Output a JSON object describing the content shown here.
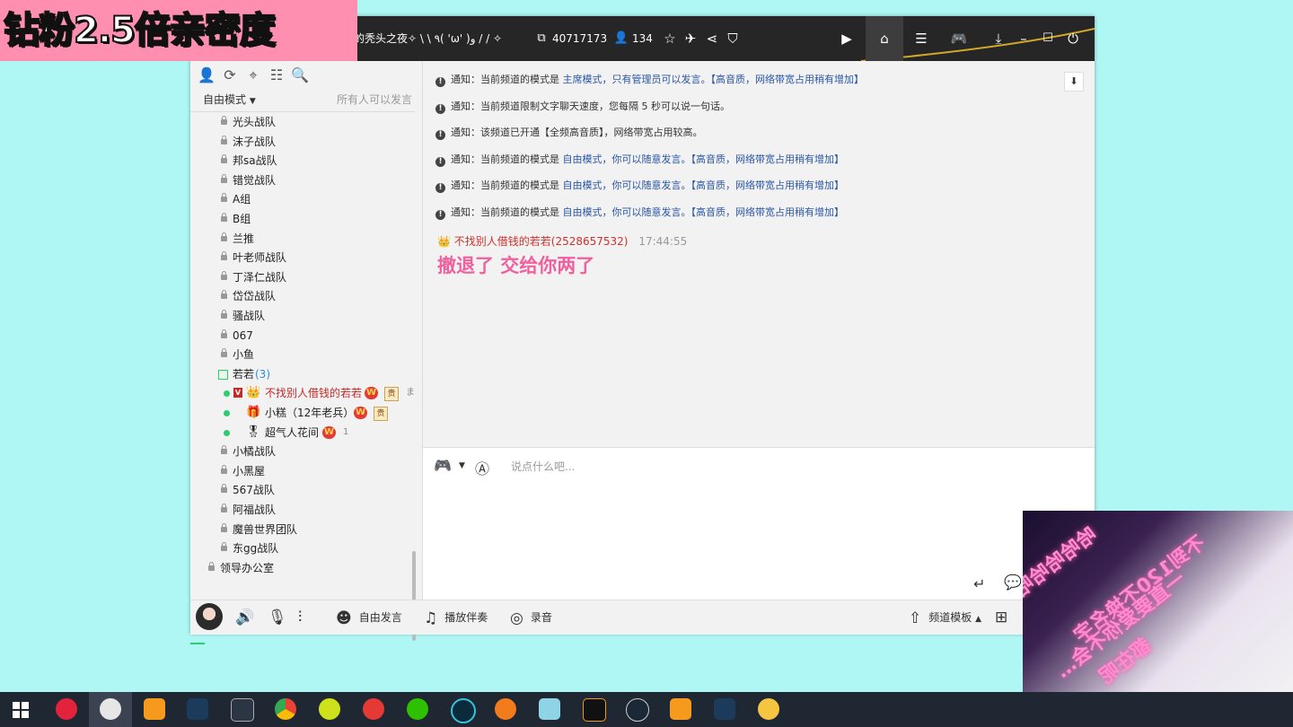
{
  "overlay_caption": "钻粉2.5倍亲密度",
  "titlebar": {
    "channel_name": "的秃头之夜✧ \\ \\ ٩( 'ω' )و / / ✧",
    "channel_id": "40717173",
    "user_count": "134"
  },
  "left_panel": {
    "mode_label": "自由模式",
    "mode_hint": "所有人可以发言",
    "channels_top": [
      "光头战队",
      "沫子战队",
      "邦sa战队",
      "错觉战队",
      "A组",
      "B组",
      "兰推",
      "叶老师战队",
      "丁泽仁战队",
      "岱岱战队",
      "骚战队",
      "067",
      "小鱼"
    ],
    "current_channel": {
      "name": "若若",
      "count": "(3)"
    },
    "members": [
      {
        "name": "不找别人借钱的若若",
        "badge_v": "V",
        "noble": "贵",
        "extra": "ま"
      },
      {
        "name": "小糕（12年老兵）",
        "noble": "贵"
      },
      {
        "name": "超气人花间",
        "extra": "1"
      }
    ],
    "channels_bottom": [
      "小橘战队",
      "小黑屋",
      "567战队",
      "阿福战队",
      "魔兽世界团队",
      "东gg战队"
    ],
    "root_channel": "领导办公室"
  },
  "chat": {
    "notices": [
      {
        "prefix": "通知：当前频道的模式是 ",
        "emph": "主席模式，只有管理员可以发言。【高音质，网络带宽占用稍有增加】",
        "rest": ""
      },
      {
        "prefix": "通知：当前频道限制文字聊天速度，您每隔 5 秒可以说一句话。",
        "emph": "",
        "rest": ""
      },
      {
        "prefix": "通知：该频道已开通【全频高音质】，网络带宽占用较高。",
        "emph": "",
        "rest": ""
      },
      {
        "prefix": "通知：当前频道的模式是 ",
        "emph": "自由模式，你可以随意发言。【高音质，网络带宽占用稍有增加】",
        "rest": ""
      },
      {
        "prefix": "通知：当前频道的模式是 ",
        "emph": "自由模式，你可以随意发言。【高音质，网络带宽占用稍有增加】",
        "rest": ""
      },
      {
        "prefix": "通知：当前频道的模式是 ",
        "emph": "自由模式，你可以随意发言。【高音质，网络带宽占用稍有增加】",
        "rest": ""
      }
    ],
    "message": {
      "sender": "不找别人借钱的若若(2528657532)",
      "time": "17:44:55",
      "text": "撤退了 交给你两了"
    },
    "input_placeholder": "说点什么吧..."
  },
  "bottom_bar": {
    "free_speak": "自由发言",
    "play_music": "播放伴奏",
    "record": "录音",
    "template": "频道模板"
  },
  "webcam": {
    "lines": [
      "哈哈哈哈哈",
      "不到120不换名字",
      "一直要爱你不会…",
      "都在呢"
    ]
  },
  "colors": {
    "background": "#aef7f4",
    "overlay": "#ff8fb0",
    "message_pink": "#f0609e",
    "sender_red": "#d2302b",
    "titlebar": "#262626"
  }
}
